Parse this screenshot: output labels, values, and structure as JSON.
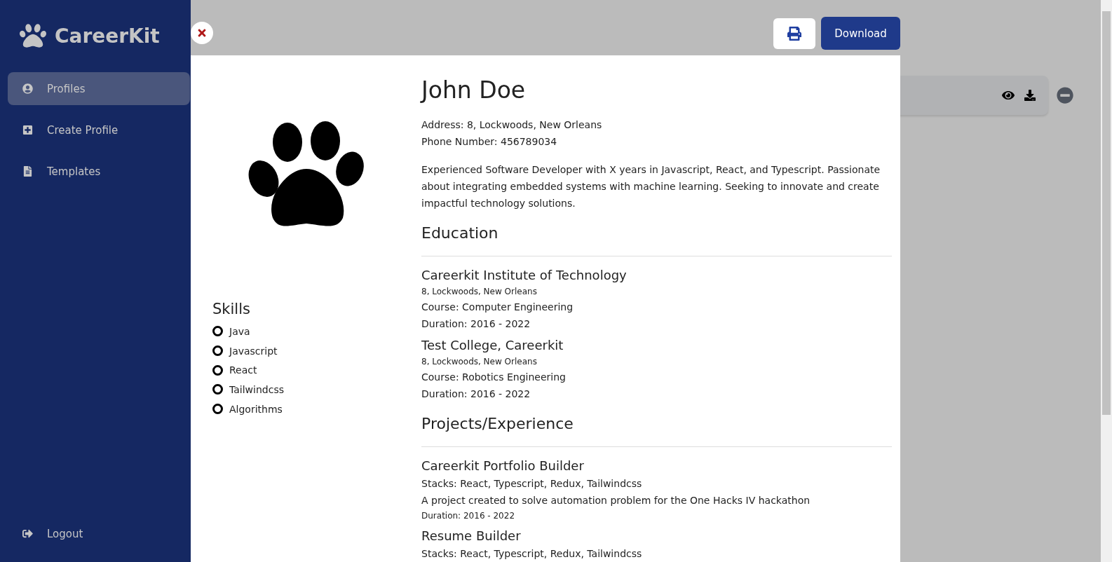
{
  "sidebar": {
    "logo": "CareerKit",
    "items": [
      {
        "label": "Profiles",
        "selected": true
      },
      {
        "label": "Create Profile",
        "selected": false
      },
      {
        "label": "Templates",
        "selected": false
      }
    ],
    "logout": "Logout"
  },
  "toolbar": {
    "download": "Download"
  },
  "resume": {
    "name": "John Doe",
    "contact": [
      "Address: 8, Lockwoods, New Orleans",
      "Phone Number: 456789034"
    ],
    "summary": "Experienced Software Developer with X years in Javascript, React, and Typescript. Passionate about integrating embedded systems with machine learning. Seeking to innovate and create impactful technology solutions.",
    "skills_title": "Skills",
    "skills": [
      "Java",
      "Javascript",
      "React",
      "Tailwindcss",
      "Algorithms"
    ],
    "sections": [
      {
        "title": "Education",
        "items": [
          {
            "title": "Careerkit Institute of Technology",
            "lines": [
              {
                "text": "8, Lockwoods, New Orleans",
                "kind": "small"
              },
              {
                "text": "Course: Computer Engineering",
                "kind": "normal"
              },
              {
                "text": "Duration: 2016 - 2022",
                "kind": "normal"
              }
            ]
          },
          {
            "title": "Test College, Careerkit",
            "lines": [
              {
                "text": "8, Lockwoods, New Orleans",
                "kind": "small"
              },
              {
                "text": "Course: Robotics Engineering",
                "kind": "normal"
              },
              {
                "text": "Duration: 2016 - 2022",
                "kind": "normal"
              }
            ]
          }
        ]
      },
      {
        "title": "Projects/Experience",
        "items": [
          {
            "title": "Careerkit Portfolio Builder",
            "lines": [
              {
                "text": "Stacks: React, Typescript, Redux, Tailwindcss",
                "kind": "normal"
              },
              {
                "text": "A project created to solve automation problem for the One Hacks IV hackathon",
                "kind": "normal"
              },
              {
                "text": "Duration: 2016 - 2022",
                "kind": "small"
              }
            ]
          },
          {
            "title": "Resume Builder",
            "lines": [
              {
                "text": "Stacks: React, Typescript, Redux, Tailwindcss",
                "kind": "normal"
              }
            ]
          }
        ]
      }
    ]
  }
}
